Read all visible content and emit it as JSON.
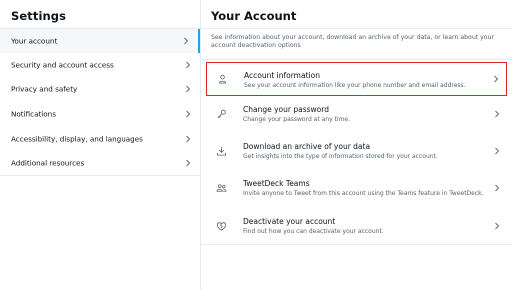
{
  "settings": {
    "title": "Settings",
    "items": [
      {
        "label": "Your account",
        "active": true
      },
      {
        "label": "Security and account access",
        "active": false
      },
      {
        "label": "Privacy and safety",
        "active": false
      },
      {
        "label": "Notifications",
        "active": false
      },
      {
        "label": "Accessibility, display, and languages",
        "active": false
      },
      {
        "label": "Additional resources",
        "active": false
      }
    ]
  },
  "account": {
    "title": "Your Account",
    "intro": "See information about your account, download an archive of your data, or learn about your account deactivation options",
    "items": [
      {
        "title": "Account information",
        "desc": "See your account information like your phone number and email address.",
        "icon": "person-icon",
        "highlighted": true
      },
      {
        "title": "Change your password",
        "desc": "Change your password at any time.",
        "icon": "key-icon",
        "highlighted": false
      },
      {
        "title": "Download an archive of your data",
        "desc": "Get insights into the type of information stored for your account.",
        "icon": "download-icon",
        "highlighted": false
      },
      {
        "title": "TweetDeck Teams",
        "desc": "Invite anyone to Tweet from this account using the Teams feature in TweetDeck.",
        "icon": "people-icon",
        "highlighted": false
      },
      {
        "title": "Deactivate your account",
        "desc": "Find out how you can deactivate your account.",
        "icon": "broken-heart-icon",
        "highlighted": false
      }
    ]
  },
  "colors": {
    "accent": "#1da1f2",
    "highlight_border": "#d9262b",
    "secondary_text": "#536471",
    "divider": "#e6ecf0"
  }
}
